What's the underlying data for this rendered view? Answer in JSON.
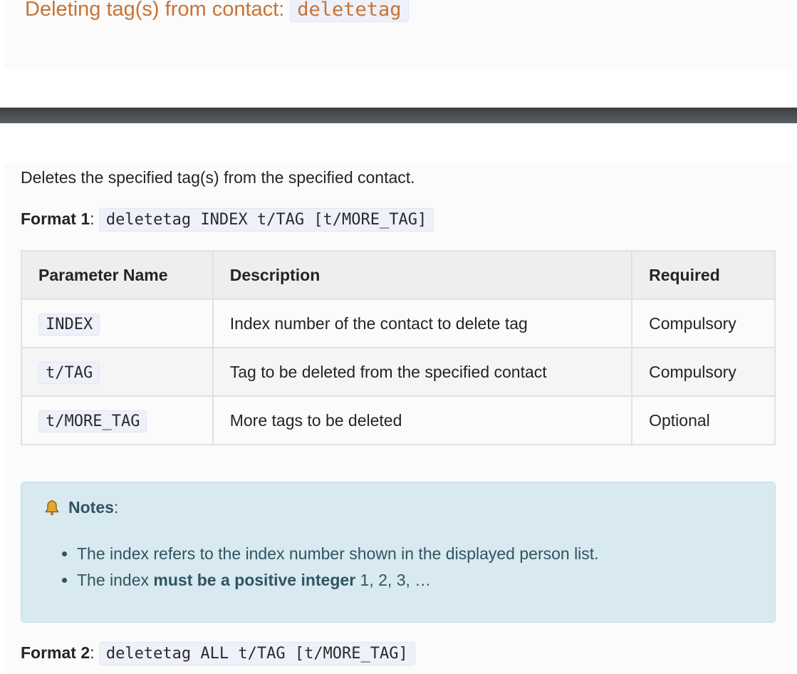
{
  "heading": {
    "text": "Deleting tag(s) from contact:",
    "command": "deletetag"
  },
  "description": "Deletes the specified tag(s) from the specified contact.",
  "format1": {
    "label": "Format 1",
    "colon": ":",
    "syntax": "deletetag INDEX t/TAG [t/MORE_TAG]"
  },
  "table": {
    "headers": [
      "Parameter Name",
      "Description",
      "Required"
    ],
    "rows": [
      {
        "param": "INDEX",
        "description": "Index number of the contact to delete tag",
        "required": "Compulsory"
      },
      {
        "param": "t/TAG",
        "description": "Tag to be deleted from the specified contact",
        "required": "Compulsory"
      },
      {
        "param": "t/MORE_TAG",
        "description": "More tags to be deleted",
        "required": "Optional"
      }
    ]
  },
  "notes": {
    "icon": "bell-icon",
    "title": "Notes",
    "colon": ":",
    "item1": "The index refers to the index number shown in the displayed person list.",
    "item2_pre": "The index ",
    "item2_bold": "must be a positive integer",
    "item2_post": " 1, 2, 3, …"
  },
  "format2": {
    "label": "Format 2",
    "colon": ":",
    "syntax": "deletetag ALL t/TAG [t/MORE_TAG]"
  },
  "colors": {
    "heading": "#c77336",
    "notes_bg": "#d9e9f0",
    "notes_text": "#2f5561",
    "dark_bar": "#3a3d42"
  }
}
